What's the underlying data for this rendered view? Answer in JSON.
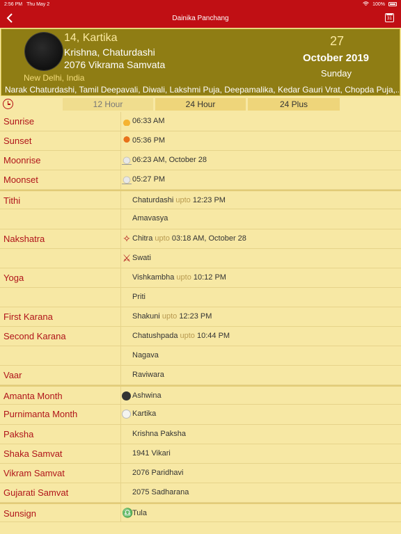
{
  "status": {
    "time": "2:56 PM",
    "date": "Thu May 2",
    "battery": "100%"
  },
  "nav": {
    "title": "Dainika Panchang",
    "calendar_badge": "31"
  },
  "header": {
    "lunar_date": "14, Kartika",
    "paksha_tithi": "Krishna, Chaturdashi",
    "samvata": "2076 Vikrama Samvata",
    "location": "New Delhi, India",
    "day": "27",
    "month_year": "October 2019",
    "weekday": "Sunday",
    "festivals": "Narak Chaturdashi, Tamil Deepavali, Diwali, Lakshmi Puja, Deepamalika, Kedar Gauri Vrat, Chopda Puja,..."
  },
  "tabs": [
    "12 Hour",
    "24 Hour",
    "24 Plus"
  ],
  "rows": {
    "sunrise": {
      "label": "Sunrise",
      "value": "06:33 AM"
    },
    "sunset": {
      "label": "Sunset",
      "value": "05:36 PM"
    },
    "moonrise": {
      "label": "Moonrise",
      "value": "06:23 AM, October 28"
    },
    "moonset": {
      "label": "Moonset",
      "value": "05:27 PM"
    },
    "tithi": {
      "label": "Tithi",
      "value": "Chaturdashi",
      "upto": "upto",
      "time": "12:23 PM",
      "next": "Amavasya"
    },
    "nakshatra": {
      "label": "Nakshatra",
      "value": "Chitra",
      "upto": "upto",
      "time": "03:18 AM, October 28",
      "next": "Swati"
    },
    "yoga": {
      "label": "Yoga",
      "value": "Vishkambha",
      "upto": "upto",
      "time": "10:12 PM",
      "next": "Priti"
    },
    "first_karana": {
      "label": "First Karana",
      "value": "Shakuni",
      "upto": "upto",
      "time": "12:23 PM"
    },
    "second_karana": {
      "label": "Second Karana",
      "value": "Chatushpada",
      "upto": "upto",
      "time": "10:44 PM",
      "next": "Nagava"
    },
    "vaar": {
      "label": "Vaar",
      "value": "Raviwara"
    },
    "amanta_month": {
      "label": "Amanta Month",
      "value": "Ashwina"
    },
    "purnimanta_month": {
      "label": "Purnimanta Month",
      "value": "Kartika"
    },
    "paksha": {
      "label": "Paksha",
      "value": "Krishna Paksha"
    },
    "shaka_samvat": {
      "label": "Shaka Samvat",
      "value": "1941 Vikari"
    },
    "vikram_samvat": {
      "label": "Vikram Samvat",
      "value": "2076 Paridhavi"
    },
    "gujarati_samvat": {
      "label": "Gujarati Samvat",
      "value": "2075 Sadharana"
    },
    "sunsign": {
      "label": "Sunsign",
      "value": "Tula"
    }
  },
  "colors": {
    "nav_red": "#c00f14",
    "header_olive": "#8f7d14",
    "background": "#f7e8a4",
    "label_red": "#b0141a"
  },
  "icons": [
    "back-chevron-icon",
    "calendar-icon",
    "clock-icon",
    "sunrise-icon",
    "sunset-icon",
    "moonrise-icon",
    "moonset-icon",
    "nakshatra-star-icon",
    "swati-icon",
    "dark-moon-icon",
    "full-moon-icon",
    "libra-icon"
  ]
}
